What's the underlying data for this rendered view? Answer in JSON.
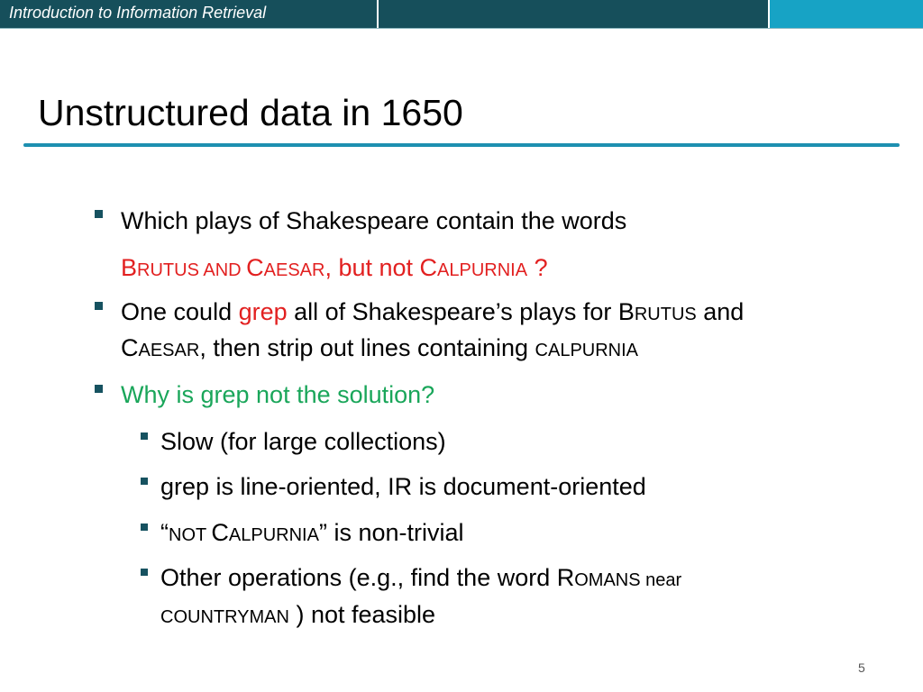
{
  "header": {
    "course_title": "Introduction to Information Retrieval"
  },
  "slide": {
    "title": "Unstructured data in 1650",
    "page_number": "5",
    "bullets": {
      "b1": {
        "line1": "Which plays of Shakespeare contain the words",
        "line2": {
          "brutus_cap": "B",
          "brutus_rest": "RUTUS",
          "and": " AND ",
          "caesar_cap": "C",
          "caesar_rest": "AESAR",
          "but_not": ", but not ",
          "calp_cap": "C",
          "calp_rest": "ALPURNIA",
          "qmark": " ?"
        }
      },
      "b2": {
        "line1": {
          "pre": "One could ",
          "grep": "grep",
          "mid": " all of Shakespeare’s plays for ",
          "brutus_cap": "B",
          "brutus_rest": "RUTUS",
          "and": " and"
        },
        "line2": {
          "caesar_cap": "C",
          "caesar_rest": "AESAR",
          "mid": ", then strip out lines containing ",
          "calpurnia": "CALPURNIA"
        }
      },
      "b3": {
        "text": "Why is grep not the solution?"
      },
      "sub": {
        "s1": {
          "text": "Slow (for large collections)"
        },
        "s2": {
          "text": "grep is line-oriented, IR is document-oriented"
        },
        "s3": {
          "open": "“",
          "not": "NOT ",
          "calp_cap": "C",
          "calp_rest": "ALPURNIA",
          "close": "”",
          "rest": " is non-trivial"
        },
        "s4": {
          "line1": {
            "pre": "Other operations (e.g., find the word ",
            "romans_cap": "R",
            "romans_rest": "OMANS",
            "near": " near"
          },
          "line2": {
            "countryman": "COUNTRYMAN",
            "rest": " ) not feasible"
          }
        }
      }
    }
  },
  "colors": {
    "header_dark": "#164f5b",
    "header_light": "#17a3c5",
    "rule": "#1d8fb0",
    "red": "#e22020",
    "green": "#1aa65a"
  }
}
